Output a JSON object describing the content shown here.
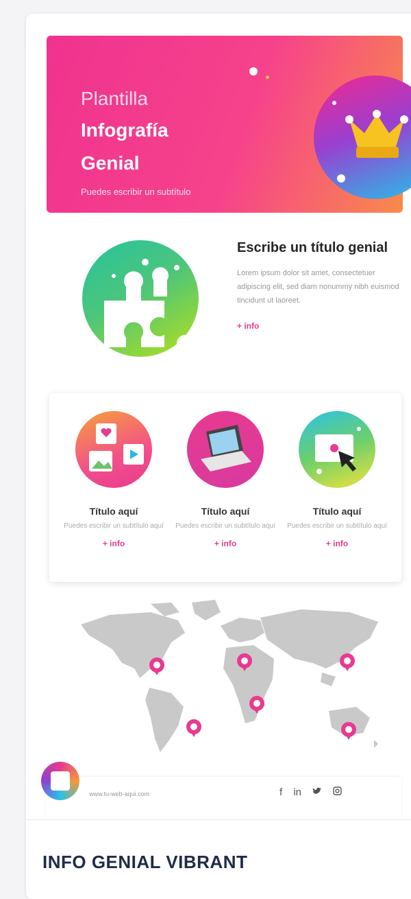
{
  "hero": {
    "title_light": "Plantilla",
    "title_line1": "Infografía",
    "title_line2": "Genial",
    "subtitle": "Puedes escribir un subtítulo"
  },
  "section2": {
    "heading": "Escribe un título genial",
    "body": "Lorem ipsum dolor sit amet, consectetuer adipiscing elit, sed diam nonummy nibh euismod tincidunt ut laoreet.",
    "more": "+ info"
  },
  "features": [
    {
      "title": "Título aquí",
      "desc": "Puedes escribir un subtítulo aquí",
      "more": "+ info"
    },
    {
      "title": "Título aquí",
      "desc": "Puedes escribir un subtítulo aquí",
      "more": "+ info"
    },
    {
      "title": "Título aquí",
      "desc": "Puedes escribir un subtítulo aquí",
      "more": "+ info"
    }
  ],
  "footer": {
    "url": "www.tu-web-aqui.com",
    "social": [
      "f",
      "in",
      "t",
      "ig"
    ],
    "title": "INFO GENIAL VIBRANT"
  },
  "colors": {
    "accent": "#e83a8f",
    "navy": "#1f2b49"
  }
}
